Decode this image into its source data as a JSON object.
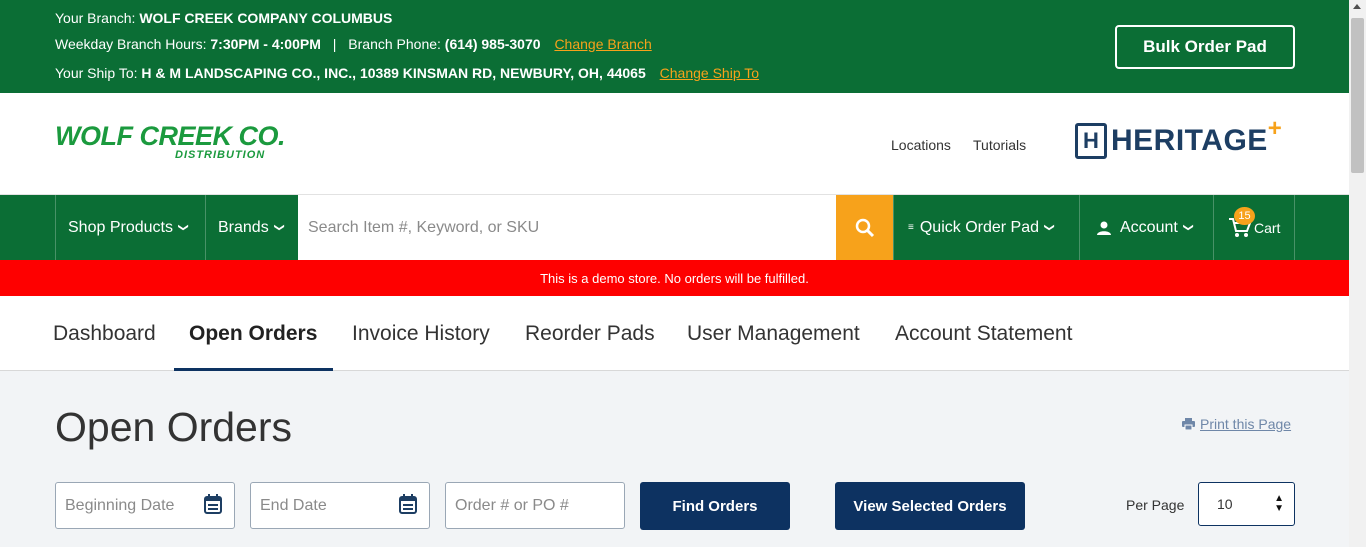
{
  "topbar": {
    "branch_label": "Your Branch:",
    "branch_name": "WOLF CREEK COMPANY COLUMBUS",
    "hours_label": "Weekday Branch Hours:",
    "hours_value": "7:30PM - 4:00PM",
    "separator": "|",
    "phone_label": "Branch Phone:",
    "phone_value": "(614) 985-3070",
    "change_branch": "Change Branch",
    "ship_label": "Your Ship To:",
    "ship_value": "H & M LANDSCAPING CO., INC., 10389 KINSMAN RD, NEWBURY, OH, 44065",
    "change_ship": "Change Ship To",
    "bulk_order_pad": "Bulk Order Pad"
  },
  "header": {
    "logo_main": "WOLF CREEK CO.",
    "logo_sub": "DISTRIBUTION",
    "locations": "Locations",
    "tutorials": "Tutorials",
    "heritage": "HERITAGE"
  },
  "nav": {
    "shop_products": "Shop Products",
    "brands": "Brands",
    "search_placeholder": "Search Item #, Keyword, or SKU",
    "quick_order_pad": "Quick Order Pad",
    "account": "Account",
    "cart": "Cart",
    "cart_count": "15"
  },
  "demo_notice": "This is a demo store. No orders will be fulfilled.",
  "tabs": [
    "Dashboard",
    "Open Orders",
    "Invoice History",
    "Reorder Pads",
    "User Management",
    "Account Statement"
  ],
  "main": {
    "title": "Open Orders",
    "print": "Print this Page",
    "beginning_date_placeholder": "Beginning Date",
    "end_date_placeholder": "End Date",
    "order_placeholder": "Order # or PO #",
    "find_orders": "Find Orders",
    "view_selected": "View Selected Orders",
    "per_page_label": "Per Page",
    "per_page_value": "10"
  },
  "colors": {
    "brand_green": "#0b6e35",
    "accent_orange": "#f7a21b",
    "navy": "#0d3261",
    "alert_red": "#fe0000"
  }
}
